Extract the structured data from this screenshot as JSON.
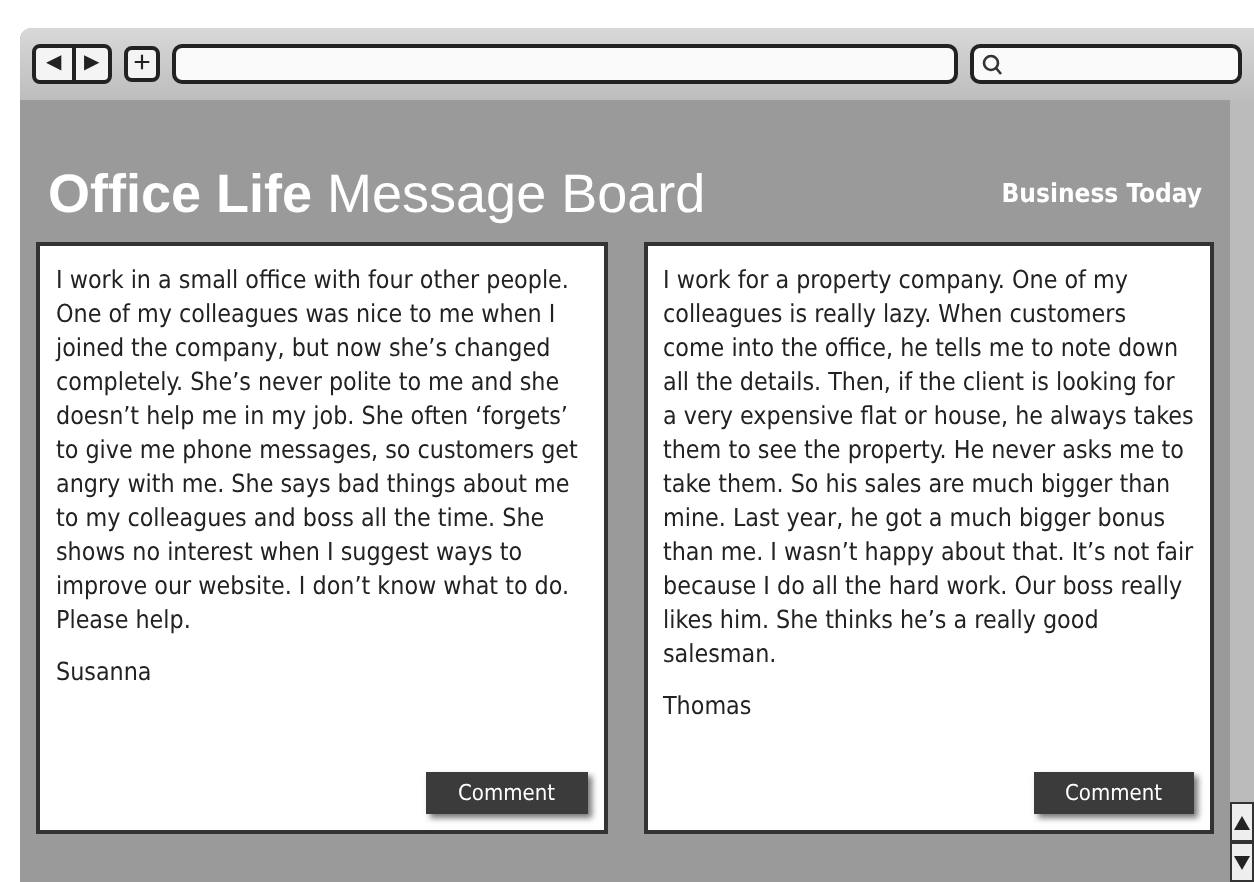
{
  "toolbar": {
    "back": "◀",
    "forward": "▶",
    "new_tab": "+"
  },
  "header": {
    "title": "**Office Life** Message Board",
    "brand": "Business Today"
  },
  "posts": [
    {
      "text": "I work in a small office with four other people. One of my colleagues was nice to me when I joined the company, but now she’s changed completely. She’s never polite to me and she doesn’t help me in my job. She often ‘forgets’ to give me phone messages, so customers get angry with me. She says bad things about me to my colleagues and boss all the time. She shows no interest when I suggest ways to improve our website. I don’t know what to do. Please help.",
      "author": "Susanna",
      "button": "Comment"
    },
    {
      "text": "I work for a property company. One of my colleagues is really lazy. When customers come into the office, he tells me to note down all the details. Then, if the client is looking for a very expensive flat or house, he always takes them to see the property. He never asks me to take them. So his sales are much bigger than mine. Last year, he got a much bigger bonus than me. I wasn’t happy about that. It’s not fair because I do all the hard work. Our boss really likes him. She thinks he’s a really good salesman.",
      "author": "Thomas",
      "button": "Comment"
    }
  ]
}
